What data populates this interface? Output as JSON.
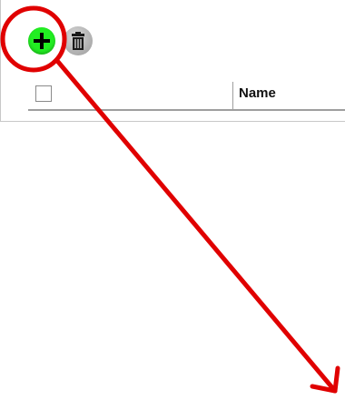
{
  "toolbar": {
    "add_icon": "plus-icon",
    "delete_icon": "trash-icon",
    "add_color": "#22ee22",
    "delete_color": "#b0b0b0"
  },
  "table": {
    "columns": [
      {
        "label": ""
      },
      {
        "label": "Name"
      }
    ]
  },
  "annotation": {
    "color": "#e00000"
  }
}
